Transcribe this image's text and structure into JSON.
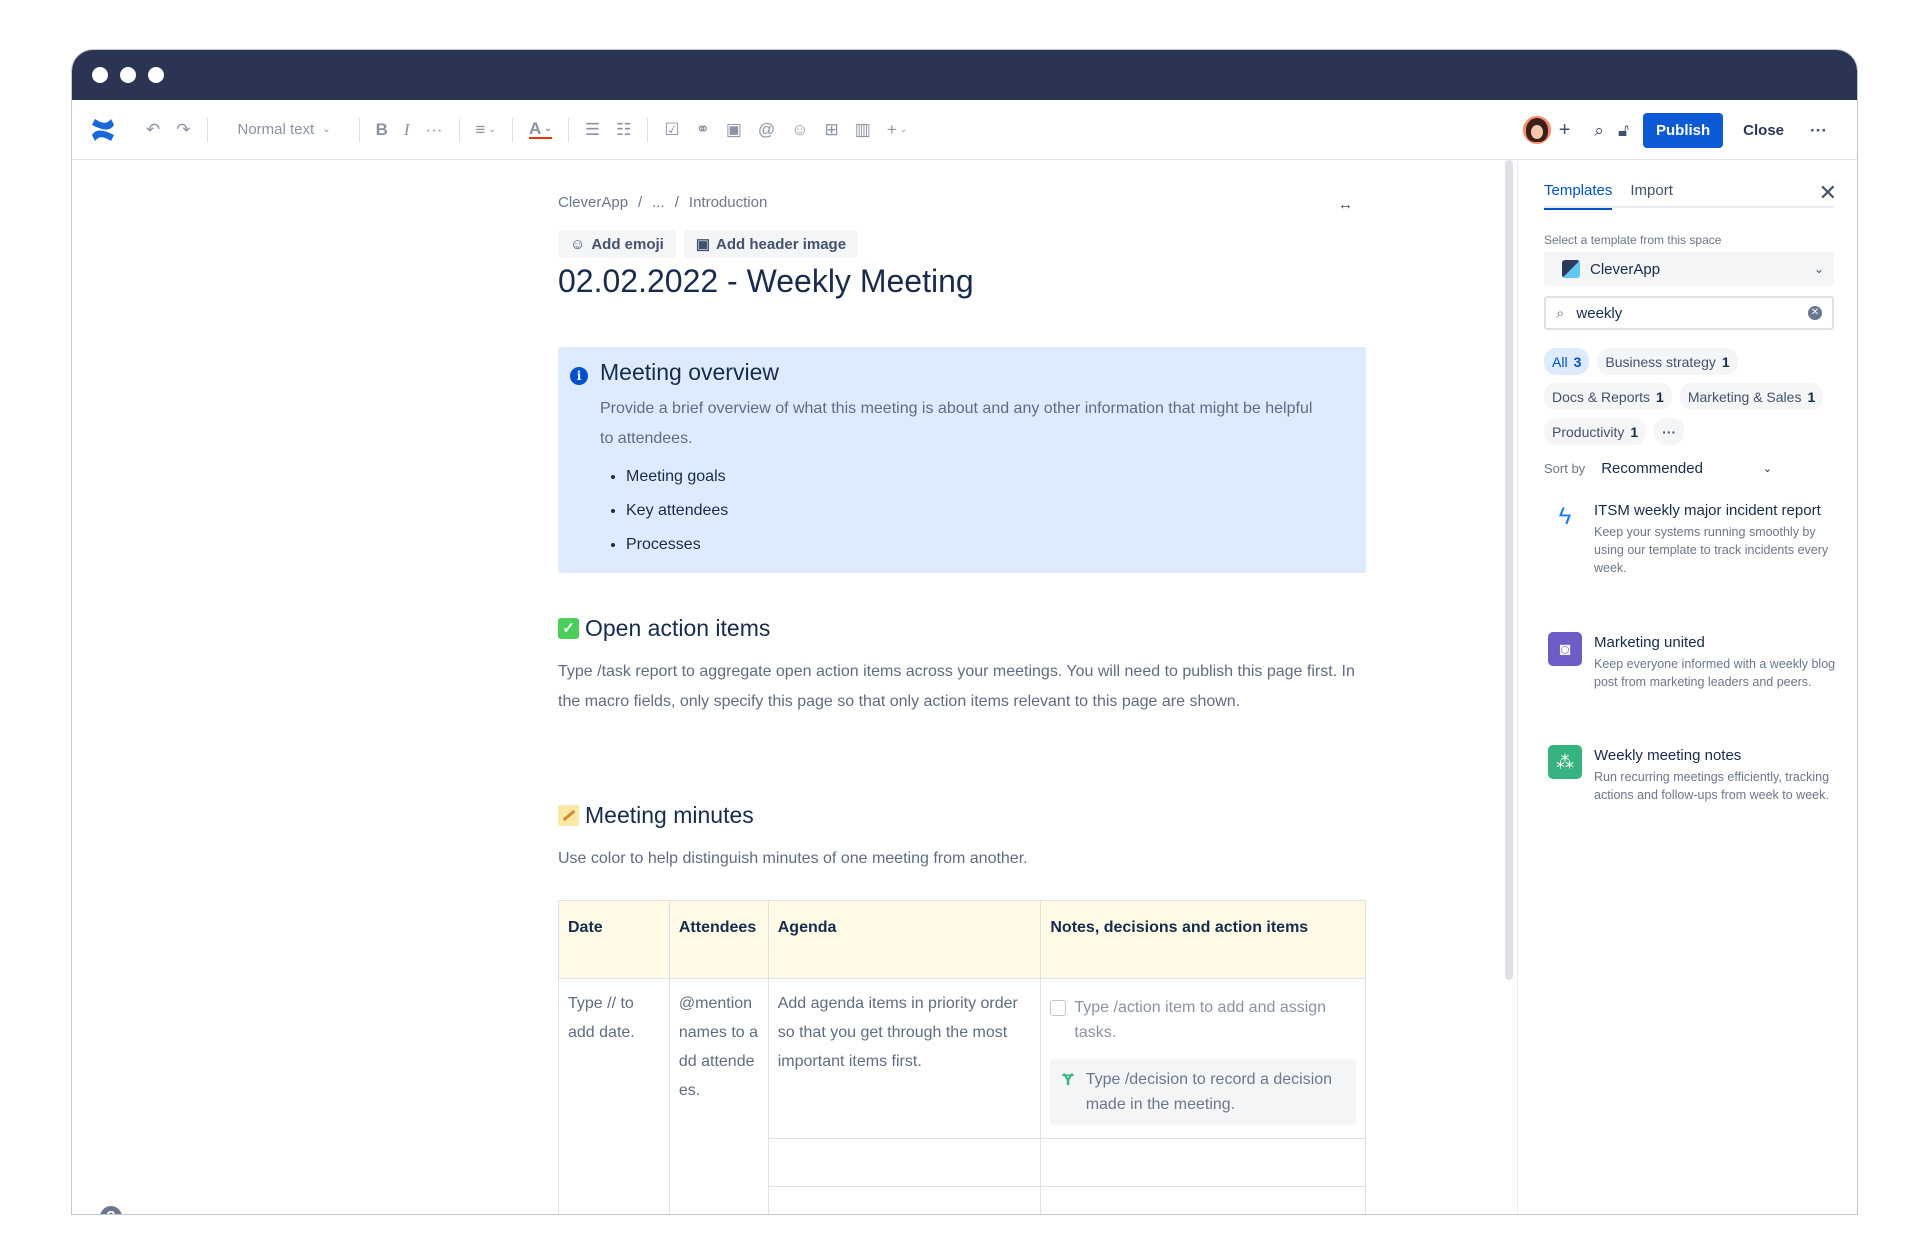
{
  "toolbar": {
    "text_style": "Normal text",
    "publish_label": "Publish",
    "close_label": "Close",
    "icons": [
      "undo-icon",
      "redo-icon",
      "bold-icon",
      "italic-icon",
      "more-formatting-icon",
      "align-icon",
      "text-color-icon",
      "bullet-list-icon",
      "numbered-list-icon",
      "action-item-icon",
      "link-icon",
      "image-icon",
      "mention-icon",
      "emoji-icon",
      "table-icon",
      "layouts-icon",
      "insert-icon"
    ]
  },
  "page": {
    "breadcrumb": [
      "CleverApp",
      "/",
      "...",
      "/",
      "Introduction"
    ],
    "add_emoji": "Add emoji",
    "add_header_image": "Add header image",
    "title": "02.02.2022 - Weekly Meeting",
    "overview": {
      "heading": "Meeting overview",
      "text": "Provide a brief overview of what this meeting is about and any other information that might be helpful to attendees.",
      "bullets": [
        "Meeting goals",
        "Key attendees",
        "Processes"
      ]
    },
    "action_items": {
      "heading": "Open action items",
      "text": "Type /task report to aggregate open action items across your meetings. You will need to publish this page first. In the macro fields, only specify this page so that only action items relevant to this page are shown."
    },
    "minutes": {
      "heading": "Meeting minutes",
      "text": "Use color to help distinguish minutes of one meeting from another."
    },
    "table": {
      "headers": [
        "Date",
        "Attendees",
        "Agenda",
        "Notes, decisions and action items"
      ],
      "date_cell": "Type // to add date.",
      "attendees_cell": "@mention names to add attendees.",
      "agenda_cell": "Add agenda items in priority order so that you get through the most important items first.",
      "action_placeholder": "Type /action item to add and assign tasks.",
      "decision_placeholder": "Type /decision to record a decision made in the meeting."
    }
  },
  "panel": {
    "tabs": [
      "Templates",
      "Import"
    ],
    "select_label": "Select a template from this space",
    "space": "CleverApp",
    "search_value": "weekly",
    "chips": [
      {
        "label": "All",
        "count": "3"
      },
      {
        "label": "Business strategy",
        "count": "1"
      },
      {
        "label": "Docs & Reports",
        "count": "1"
      },
      {
        "label": "Marketing & Sales",
        "count": "1"
      },
      {
        "label": "Productivity",
        "count": "1"
      }
    ],
    "more_chip": "···",
    "sort_label": "Sort by",
    "sort_value": "Recommended",
    "templates": [
      {
        "title": "ITSM weekly major incident report",
        "desc": "Keep your systems running smoothly by using our template to track incidents every week.",
        "color": "#1d7afc"
      },
      {
        "title": "Marketing united",
        "desc": "Keep everyone informed with a weekly blog post from marketing leaders and peers.",
        "color": "#6e5dc6"
      },
      {
        "title": "Weekly meeting notes",
        "desc": "Run recurring meetings efficiently, tracking actions and follow-ups from week to week.",
        "color": "#36b37e"
      }
    ]
  }
}
